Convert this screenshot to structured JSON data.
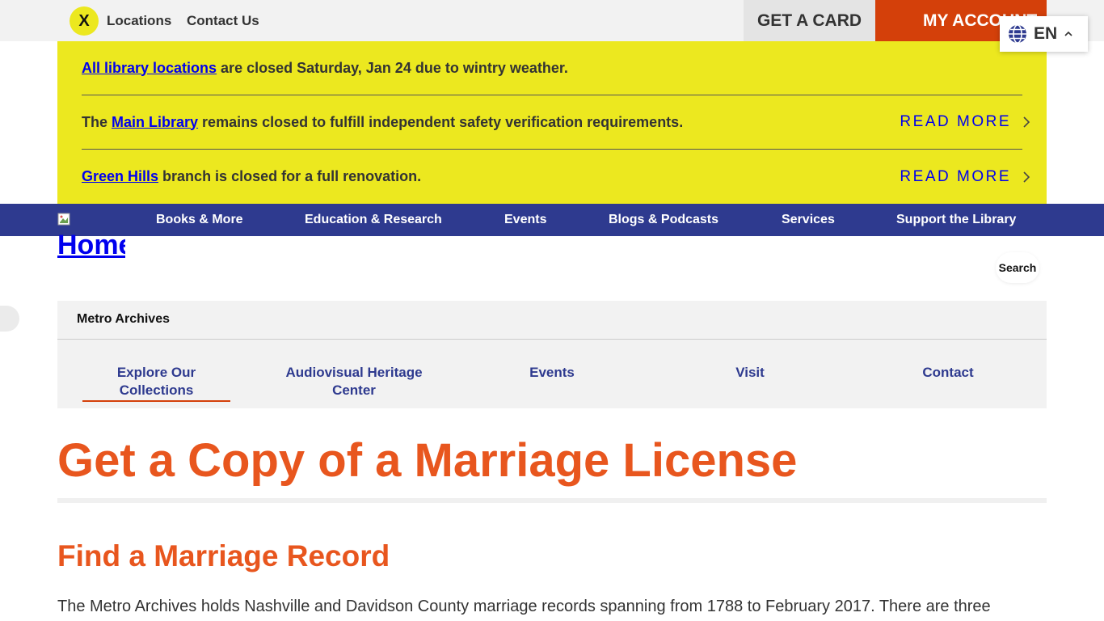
{
  "topbar": {
    "close_label": "X",
    "locations_label": "Locations",
    "contact_label": "Contact Us",
    "get_card_label": "GET A CARD",
    "my_account_label": "MY ACCOUNT",
    "language_code": "EN"
  },
  "alerts": [
    {
      "link": "All library locations",
      "text": " are closed Saturday, Jan 24 due to wintry weather.",
      "prefix": ""
    },
    {
      "prefix": "The ",
      "link": "Main Library",
      "text": " remains closed to fulfill independent safety verification requirements.",
      "read_more": "READ MORE"
    },
    {
      "prefix": "",
      "link": "Green Hills",
      "text": " branch is closed for a full renovation.",
      "read_more": "READ MORE"
    }
  ],
  "main_nav": {
    "home_label": "Home",
    "items": [
      "Books & More",
      "Education & Research",
      "Events",
      "Blogs & Podcasts",
      "Services",
      "Support the Library"
    ]
  },
  "search": {
    "label": "Search"
  },
  "subsite": {
    "title": "Metro Archives",
    "nav": [
      "Explore Our Collections",
      "Audiovisual Heritage Center",
      "Events",
      "Visit",
      "Contact"
    ]
  },
  "content": {
    "page_title": "Get a Copy of a Marriage License",
    "section_title": "Find a Marriage Record",
    "body": "The Metro Archives holds Nashville and Davidson County marriage records spanning from 1788 to February 2017. There are three"
  },
  "colors": {
    "alert_yellow": "#ece81f",
    "nav_blue": "#2e3a8f",
    "accent_orange": "#e8561e",
    "account_orange": "#d4400a"
  }
}
